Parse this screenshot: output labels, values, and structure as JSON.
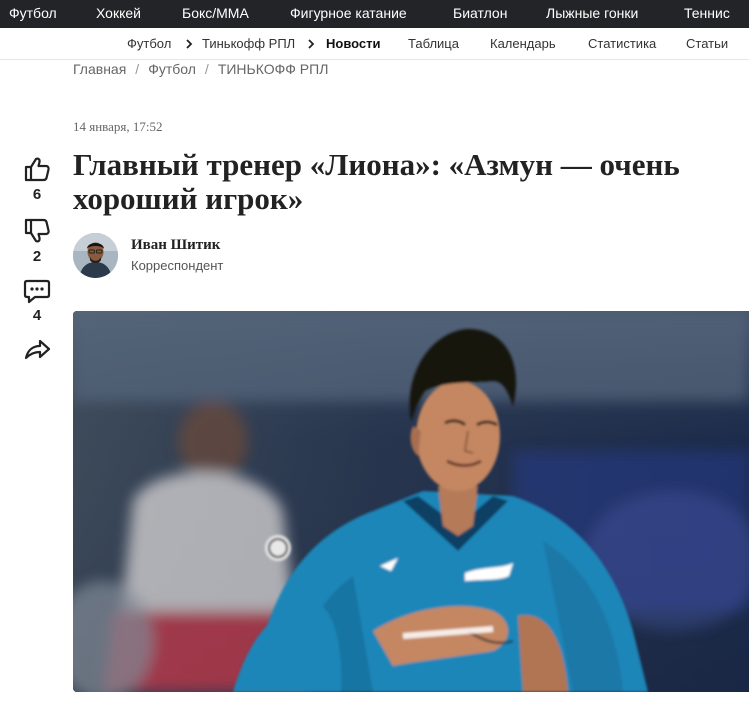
{
  "top_nav": {
    "items": [
      "Футбол",
      "Хоккей",
      "Бокс/ММА",
      "Фигурное катание",
      "Биатлон",
      "Лыжные гонки",
      "Теннис"
    ]
  },
  "sub_nav": {
    "items": [
      "Футбол",
      "Тинькофф РПЛ",
      "Новости",
      "Таблица",
      "Календарь",
      "Статистика",
      "Статьи"
    ]
  },
  "breadcrumbs": {
    "items": [
      "Главная",
      "Футбол",
      "ТИНЬКОФФ РПЛ"
    ],
    "separator": "/"
  },
  "article": {
    "date": "14 января, 17:52",
    "title_line1": "Главный тренер «Лиона»: «Азмун — очень",
    "title_line2": "хороший игрок»",
    "author": {
      "name": "Иван Шитик",
      "role": "Корреспондент"
    }
  },
  "social": {
    "likes": "6",
    "dislikes": "2",
    "comments": "4",
    "icons": [
      "thumbs-up-icon",
      "thumbs-down-icon",
      "comment-icon",
      "share-icon"
    ]
  },
  "colors": {
    "top_nav_bg": "#222428",
    "text": "#222222",
    "muted": "#666666",
    "jersey": "#1f86b8"
  }
}
